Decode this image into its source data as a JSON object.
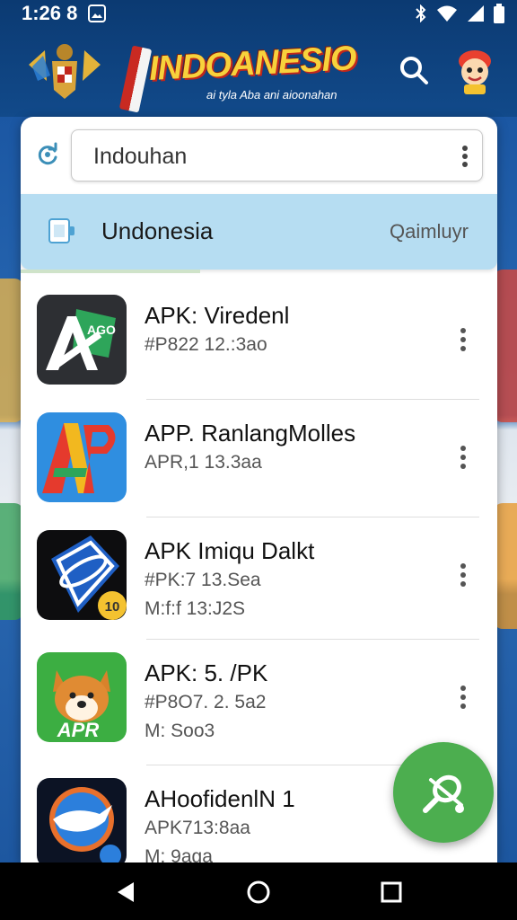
{
  "status_bar": {
    "time": "1:26 8"
  },
  "header": {
    "logo_text": "INDOANESIO",
    "logo_subtitle": "ai tyla Aba ani aioonahan"
  },
  "search": {
    "value": "Indouhan"
  },
  "tab": {
    "label": "Undonesia",
    "right_label": "Qaimluyr"
  },
  "apps": [
    {
      "title": "APK: Viredenl",
      "meta": "#P822 12.:3ao",
      "meta2": "",
      "icon": "green-a-logo-icon"
    },
    {
      "title": "APP. RanlangMolles",
      "meta": "APR,1 13.3aa",
      "meta2": "",
      "icon": "colorful-ap-logo-icon"
    },
    {
      "title": "APK Imiqu Dalkt",
      "meta": "#PK:7 13.Sea",
      "meta2": "M:f:f 13:J2S",
      "icon": "blue-diamond-logo-icon"
    },
    {
      "title": "APK: 5. /PK",
      "meta": "#P8O7. 2. 5a2",
      "meta2": "M: Soo3",
      "icon": "shiba-dog-logo-icon"
    },
    {
      "title": "AHoofidenlN  1",
      "meta": "APK713:8aa",
      "meta2": "M: 9aga",
      "icon": "blue-bird-logo-icon"
    }
  ],
  "icon_badges": {
    "app3": "10",
    "app4": "APR"
  },
  "colors": {
    "fab": "#4cae4f",
    "tab_bg": "#b6ddf2",
    "header_bg": "#0b3a72"
  }
}
